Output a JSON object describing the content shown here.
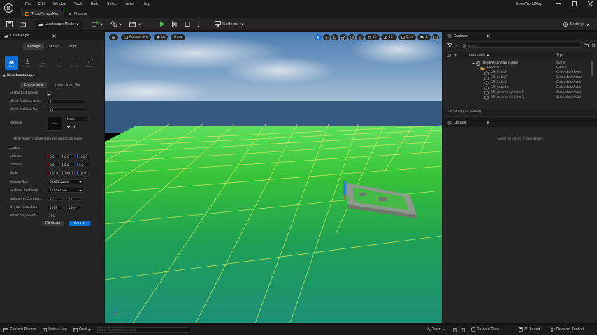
{
  "menu": [
    "File",
    "Edit",
    "Window",
    "Tools",
    "Build",
    "Select",
    "Actor",
    "Help"
  ],
  "tabs": [
    {
      "label": "ThirdPersonMap",
      "active": true
    },
    {
      "label": "Plugins",
      "active": false
    }
  ],
  "window_title": "OpenWorldMap",
  "toolbar": {
    "mode_label": "Landscape Mode",
    "platforms_label": "Platforms",
    "settings_label": "Settings"
  },
  "left_panel": {
    "title": "Landscape",
    "modes": [
      {
        "label": "Manage",
        "active": true
      },
      {
        "label": "Sculpt",
        "active": false
      },
      {
        "label": "Paint",
        "active": false
      }
    ],
    "tools": [
      {
        "label": "New",
        "icon": "new-landscape-icon",
        "active": true
      },
      {
        "label": "Import",
        "icon": "import-icon",
        "active": false
      },
      {
        "label": "Select",
        "icon": "select-tool-icon",
        "active": false
      },
      {
        "label": "Add",
        "icon": "add-tool-icon",
        "active": false
      },
      {
        "label": "Delete",
        "icon": "delete-tool-icon",
        "active": false
      },
      {
        "label": "Splines",
        "icon": "splines-tool-icon",
        "active": false
      }
    ],
    "section_new": "New Landscape",
    "create_new": "Create New",
    "import_from_file": "Import from File",
    "enable_edit_layers": "Enable Edit Layers",
    "wp_grid_label": "World Partition Grid...",
    "wp_grid_value": "2",
    "wp_region_label": "World Partition Reg...",
    "wp_region_value": "16",
    "material_label": "Material",
    "material_thumb": "None",
    "material_value": "None",
    "hint": "Hint: Assign a material to see landscape layers",
    "layers_label": "Layers",
    "location_label": "Location",
    "location": [
      "0.0",
      "0.0",
      "100.0"
    ],
    "rotation_label": "Rotation",
    "rotation": [
      "0.0",
      "0.0",
      "0.0"
    ],
    "scale_label": "Scale",
    "scale": [
      "100.0",
      "100.0",
      "100.0"
    ],
    "section_size_label": "Section Size",
    "section_size_value": "63x63 Quads",
    "sections_per_comp_label": "Sections Per Comp...",
    "sections_per_comp_value": "1x1 Section",
    "num_components_label": "Number of Compon...",
    "num_components": [
      "16",
      "16"
    ],
    "overall_res_label": "Overall Resolution",
    "overall_res": [
      "1009",
      "1009"
    ],
    "total_components_label": "Total Components",
    "total_components_value": "256",
    "fill_world": "Fill World",
    "create": "Create"
  },
  "viewport": {
    "perspective": "Perspective",
    "lit": "Lit",
    "show": "Show",
    "snap_angle": "10",
    "snap_rot": "10°",
    "snap_scale": "0.25",
    "cam_speed": "1"
  },
  "outliner": {
    "title": "Outliner",
    "search_placeholder": "Search...",
    "col_label": "Item Label",
    "col_type": "Type",
    "rows": [
      {
        "label": "ThirdPersonMap (Editor)",
        "type": "World",
        "indent": 0,
        "icon": "world-icon"
      },
      {
        "label": "Block01",
        "type": "Folder",
        "indent": 1,
        "icon": "folder-icon"
      },
      {
        "label": "SM_Cube4",
        "type": "StaticMeshActor",
        "indent": 2,
        "icon": "mesh-icon"
      },
      {
        "label": "SM_Cube7",
        "type": "StaticMeshActor",
        "indent": 2,
        "icon": "mesh-icon"
      },
      {
        "label": "SM_Cube9",
        "type": "StaticMeshActor",
        "indent": 2,
        "icon": "mesh-icon"
      },
      {
        "label": "SM_Cube10",
        "type": "StaticMeshActor",
        "indent": 2,
        "icon": "mesh-icon"
      },
      {
        "label": "SM_QuarterCylinder3",
        "type": "StaticMeshActor",
        "indent": 2,
        "icon": "mesh-icon"
      },
      {
        "label": "SM_QuarterCylinder6",
        "type": "StaticMeshActor",
        "indent": 2,
        "icon": "mesh-icon"
      }
    ],
    "actor_count": "40 actors (40 loaded)"
  },
  "details": {
    "title": "Details",
    "empty_hint": "Select an object to view details"
  },
  "status": {
    "content_drawer": "Content Drawer",
    "output_log": "Output Log",
    "cmd": "Cmd",
    "console_placeholder": "Enter Console Command",
    "trace": "Trace",
    "derived_data": "Derived Data",
    "all_saved": "All Saved",
    "revision_control": "Revision Control"
  },
  "colors": {
    "accent": "#0d6fd4",
    "grid_green": "#33c233",
    "tab_orange": "#e0a020",
    "play_green": "#3cc83c"
  }
}
